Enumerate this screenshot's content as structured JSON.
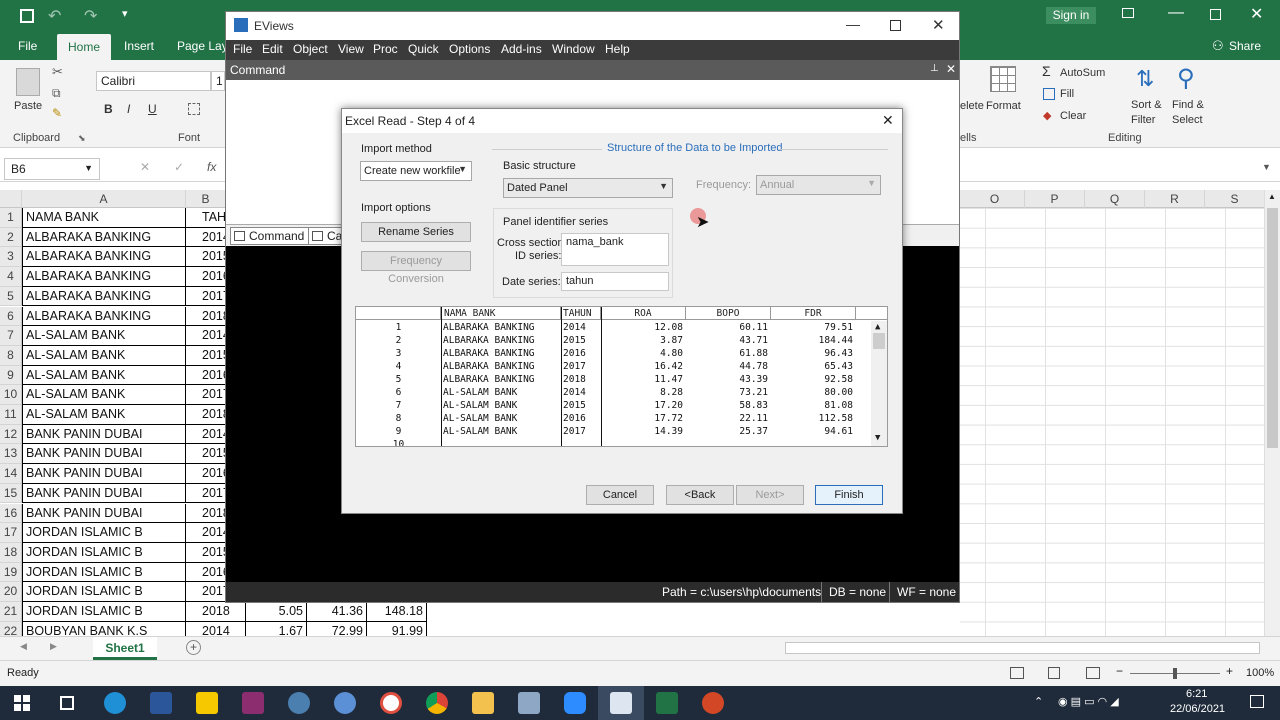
{
  "excel": {
    "title_buttons": {
      "sign_in": "Sign in"
    },
    "tabs": [
      "File",
      "Home",
      "Insert",
      "Page Layo"
    ],
    "share": "Share",
    "ribbon": {
      "paste": "Paste",
      "clipboard": "Clipboard",
      "font_group": "Font",
      "font_name": "Calibri",
      "font_size": "1",
      "bold": "B",
      "italic": "I",
      "underline": "U",
      "delete": "elete",
      "format": "Format",
      "cells": "ells",
      "autosum": "AutoSum",
      "fill": "Fill",
      "clear": "Clear",
      "sort_filter": "Sort &",
      "sort_filter2": "Filter",
      "find_select": "Find &",
      "find_select2": "Select",
      "editing": "Editing"
    },
    "name_box": "B6",
    "fx": "fx",
    "columns": [
      "A",
      "B",
      "O",
      "P",
      "Q",
      "R",
      "S"
    ],
    "rows": [
      {
        "n": "1",
        "a": "NAMA BANK",
        "b": "TAHU",
        "c": "",
        "d": "",
        "e": ""
      },
      {
        "n": "2",
        "a": "ALBARAKA BANKING",
        "b": "2014",
        "c": "",
        "d": "",
        "e": ""
      },
      {
        "n": "3",
        "a": "ALBARAKA BANKING",
        "b": "2015",
        "c": "",
        "d": "",
        "e": ""
      },
      {
        "n": "4",
        "a": "ALBARAKA BANKING",
        "b": "2016",
        "c": "",
        "d": "",
        "e": ""
      },
      {
        "n": "5",
        "a": "ALBARAKA BANKING",
        "b": "2017",
        "c": "",
        "d": "",
        "e": ""
      },
      {
        "n": "6",
        "a": "ALBARAKA BANKING",
        "b": "2018",
        "c": "",
        "d": "",
        "e": ""
      },
      {
        "n": "7",
        "a": "AL-SALAM BANK",
        "b": "2014",
        "c": "",
        "d": "",
        "e": ""
      },
      {
        "n": "8",
        "a": "AL-SALAM BANK",
        "b": "2015",
        "c": "",
        "d": "",
        "e": ""
      },
      {
        "n": "9",
        "a": "AL-SALAM BANK",
        "b": "2016",
        "c": "",
        "d": "",
        "e": ""
      },
      {
        "n": "10",
        "a": "AL-SALAM BANK",
        "b": "2017",
        "c": "",
        "d": "",
        "e": ""
      },
      {
        "n": "11",
        "a": "AL-SALAM BANK",
        "b": "2018",
        "c": "",
        "d": "",
        "e": ""
      },
      {
        "n": "12",
        "a": "BANK PANIN DUBAI",
        "b": "2014",
        "c": "",
        "d": "",
        "e": ""
      },
      {
        "n": "13",
        "a": "BANK PANIN DUBAI",
        "b": "2015",
        "c": "",
        "d": "",
        "e": ""
      },
      {
        "n": "14",
        "a": "BANK PANIN DUBAI",
        "b": "2016",
        "c": "",
        "d": "",
        "e": ""
      },
      {
        "n": "15",
        "a": "BANK PANIN DUBAI",
        "b": "2017",
        "c": "",
        "d": "",
        "e": ""
      },
      {
        "n": "16",
        "a": "BANK PANIN DUBAI",
        "b": "2018",
        "c": "",
        "d": "",
        "e": ""
      },
      {
        "n": "17",
        "a": "JORDAN ISLAMIC B",
        "b": "2014",
        "c": "",
        "d": "",
        "e": ""
      },
      {
        "n": "18",
        "a": "JORDAN ISLAMIC B",
        "b": "2015",
        "c": "",
        "d": "",
        "e": ""
      },
      {
        "n": "19",
        "a": "JORDAN ISLAMIC B",
        "b": "2016",
        "c": "",
        "d": "",
        "e": ""
      },
      {
        "n": "20",
        "a": "JORDAN ISLAMIC B",
        "b": "2017",
        "c": "",
        "d": "",
        "e": ""
      },
      {
        "n": "21",
        "a": "JORDAN ISLAMIC B",
        "b": "2018",
        "c": "5.05",
        "d": "41.36",
        "e": "148.18"
      },
      {
        "n": "22",
        "a": "BOUBYAN BANK K.S",
        "b": "2014",
        "c": "1.67",
        "d": "72.99",
        "e": "91.99"
      }
    ],
    "sheet_tab": "Sheet1",
    "status": "Ready",
    "zoom": "100%"
  },
  "eviews": {
    "title": "EViews",
    "menu": [
      "File",
      "Edit",
      "Object",
      "View",
      "Proc",
      "Quick",
      "Options",
      "Add-ins",
      "Window",
      "Help"
    ],
    "command_title": "Command",
    "command_tabs": [
      "Command",
      "Ca"
    ],
    "status": {
      "path": "Path = c:\\users\\hp\\documents",
      "db": "DB = none",
      "wf": "WF = none"
    }
  },
  "dialog": {
    "title": "Excel Read - Step 4 of 4",
    "import_method_label": "Import method",
    "import_method_value": "Create new workfile",
    "import_options_label": "Import options",
    "rename_series": "Rename Series",
    "frequency_conversion": "Frequency Conversion",
    "structure_title": "Structure of the Data to be Imported",
    "basic_structure_label": "Basic structure",
    "basic_structure_value": "Dated Panel",
    "frequency_label": "Frequency:",
    "frequency_value": "Annual",
    "panel_identifier_label": "Panel identifier series",
    "cross_section_label1": "Cross section",
    "cross_section_label2": "ID series:",
    "cross_section_value": "nama_bank",
    "date_series_label": "Date series:",
    "date_series_value": "tahun",
    "table": {
      "headers": [
        "NAMA BANK",
        "TAHUN",
        "ROA",
        "BOPO",
        "FDR"
      ],
      "rows": [
        {
          "n": "1",
          "bank": "ALBARAKA BANKING",
          "tahun": "2014",
          "roa": "12.08",
          "bopo": "60.11",
          "fdr": "79.51"
        },
        {
          "n": "2",
          "bank": "ALBARAKA BANKING",
          "tahun": "2015",
          "roa": "3.87",
          "bopo": "43.71",
          "fdr": "184.44"
        },
        {
          "n": "3",
          "bank": "ALBARAKA BANKING",
          "tahun": "2016",
          "roa": "4.80",
          "bopo": "61.88",
          "fdr": "96.43"
        },
        {
          "n": "4",
          "bank": "ALBARAKA BANKING",
          "tahun": "2017",
          "roa": "16.42",
          "bopo": "44.78",
          "fdr": "65.43"
        },
        {
          "n": "5",
          "bank": "ALBARAKA BANKING",
          "tahun": "2018",
          "roa": "11.47",
          "bopo": "43.39",
          "fdr": "92.58"
        },
        {
          "n": "6",
          "bank": "AL-SALAM BANK",
          "tahun": "2014",
          "roa": "8.28",
          "bopo": "73.21",
          "fdr": "80.00"
        },
        {
          "n": "7",
          "bank": "AL-SALAM BANK",
          "tahun": "2015",
          "roa": "17.20",
          "bopo": "58.83",
          "fdr": "81.08"
        },
        {
          "n": "8",
          "bank": "AL-SALAM BANK",
          "tahun": "2016",
          "roa": "17.72",
          "bopo": "22.11",
          "fdr": "112.58"
        },
        {
          "n": "9",
          "bank": "AL-SALAM BANK",
          "tahun": "2017",
          "roa": "14.39",
          "bopo": "25.37",
          "fdr": "94.61"
        },
        {
          "n": "10",
          "bank": "",
          "tahun": "",
          "roa": "",
          "bopo": "",
          "fdr": ""
        }
      ]
    },
    "buttons": {
      "cancel": "Cancel",
      "back": "<Back",
      "next": "Next>",
      "finish": "Finish"
    }
  },
  "taskbar": {
    "time": "6:21",
    "date": "22/06/2021"
  },
  "colors": {
    "excel_green": "#217346",
    "dialog_bg": "#f0f0f0",
    "accent_blue": "#2a6ebb"
  }
}
